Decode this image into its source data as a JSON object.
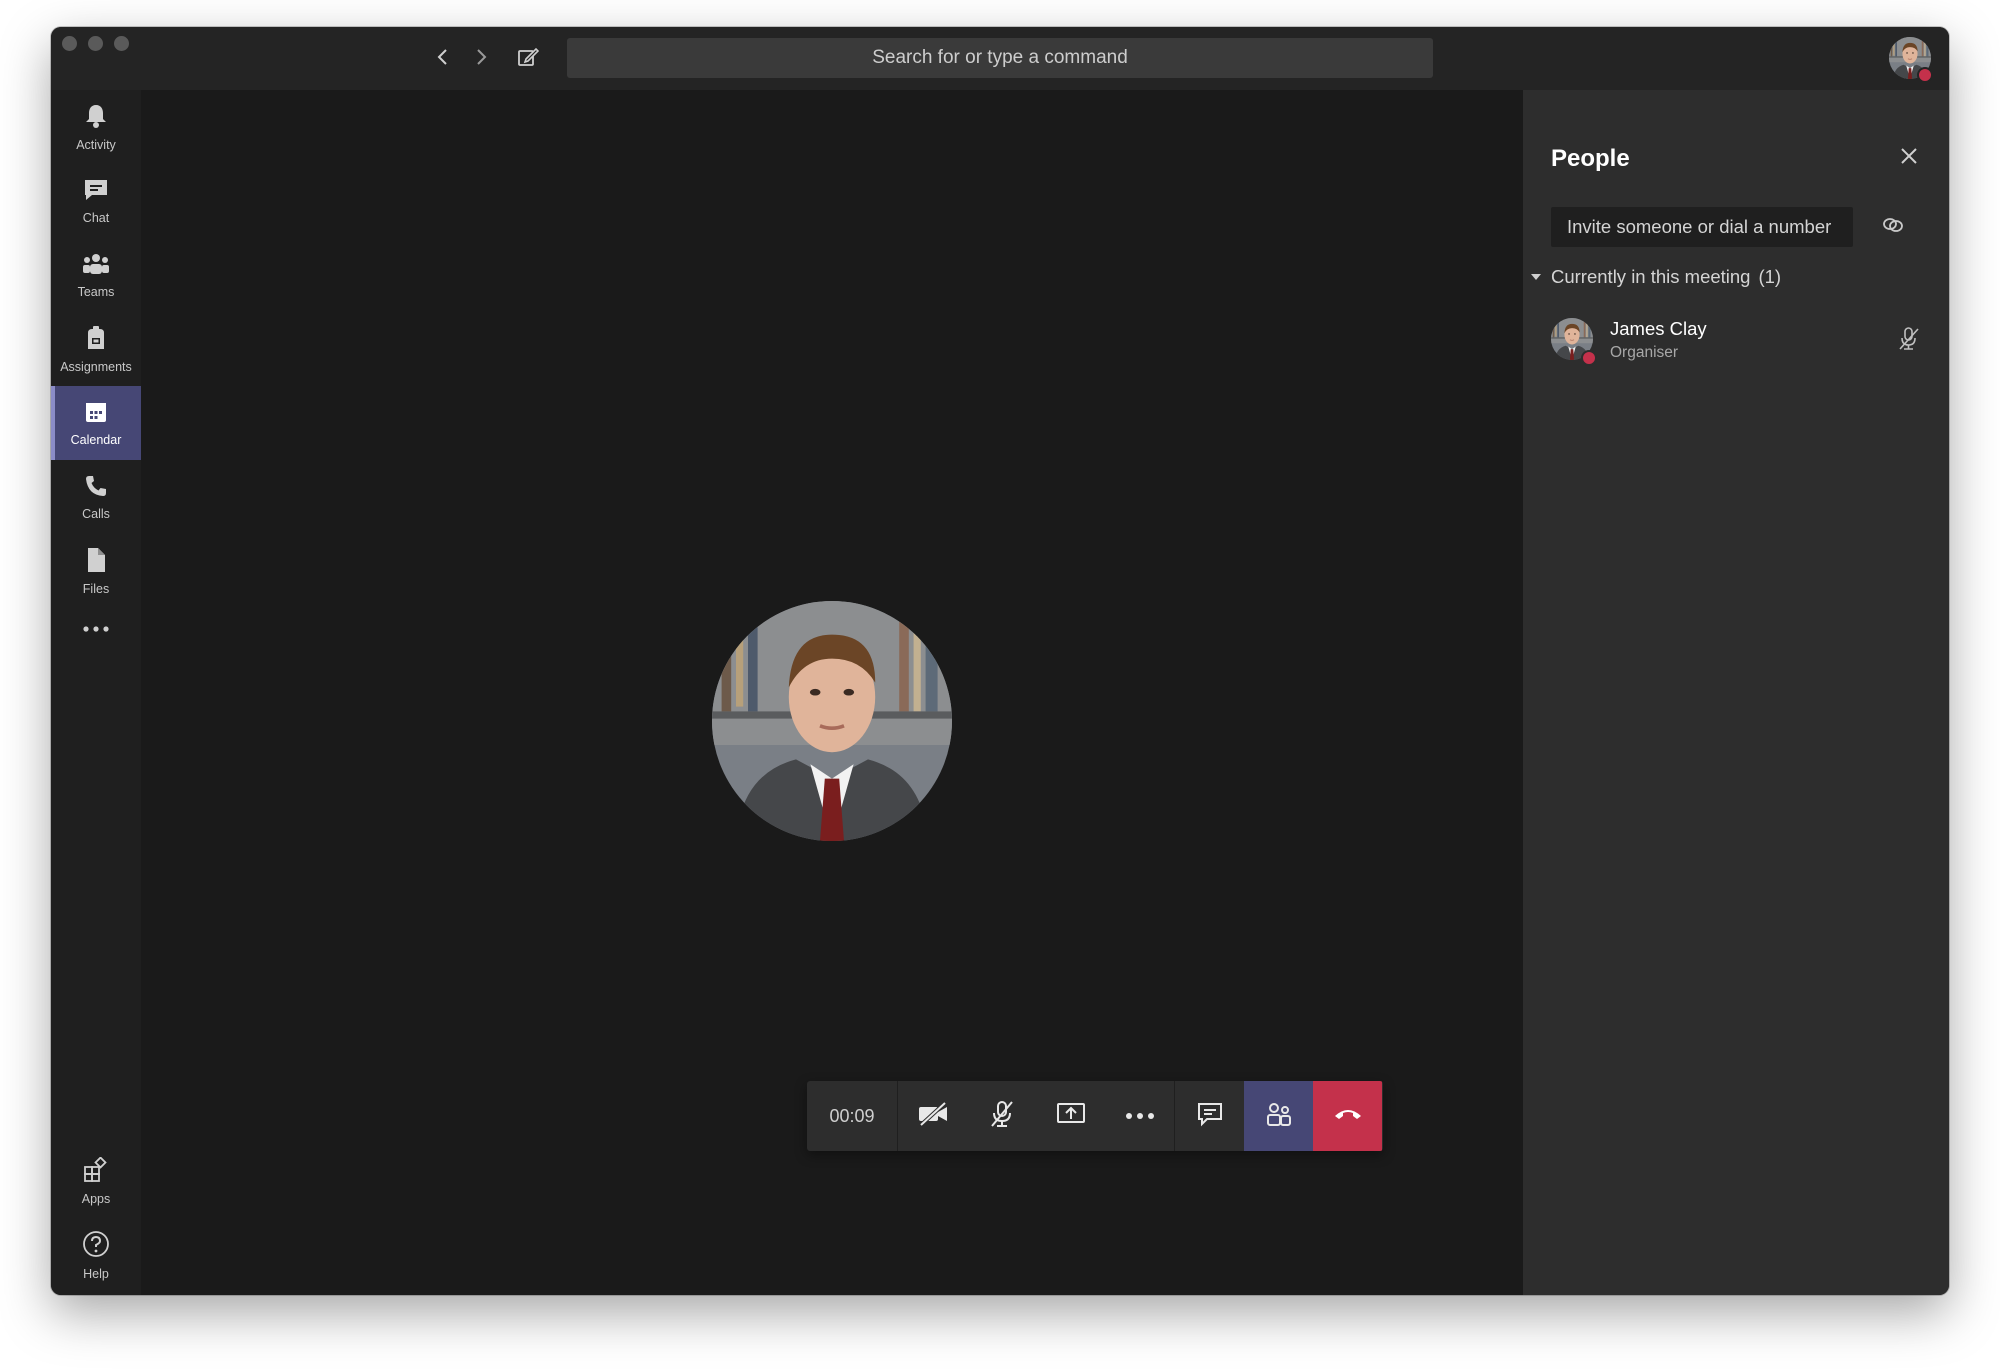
{
  "titlebar": {
    "back_icon": "chevron-left-icon",
    "forward_icon": "chevron-right-icon",
    "compose_icon": "compose-icon",
    "search_placeholder": "Search for or type a command"
  },
  "rail": {
    "items": [
      {
        "label": "Activity",
        "icon": "bell-icon"
      },
      {
        "label": "Chat",
        "icon": "chat-icon"
      },
      {
        "label": "Teams",
        "icon": "teams-icon"
      },
      {
        "label": "Assignments",
        "icon": "assignments-icon"
      },
      {
        "label": "Calendar",
        "icon": "calendar-icon",
        "active": true
      },
      {
        "label": "Calls",
        "icon": "phone-icon"
      },
      {
        "label": "Files",
        "icon": "file-icon"
      }
    ],
    "bottom": [
      {
        "label": "Apps",
        "icon": "apps-icon"
      },
      {
        "label": "Help",
        "icon": "help-icon"
      }
    ]
  },
  "call": {
    "timer": "00:09",
    "controls": [
      "camera-off-icon",
      "mic-off-icon",
      "share-screen-icon",
      "more-icon",
      "chat-icon",
      "people-icon",
      "hang-up-icon"
    ]
  },
  "people_panel": {
    "title": "People",
    "invite_placeholder": "Invite someone or dial a number",
    "section": "Currently in this meeting",
    "count": "(1)",
    "participants": [
      {
        "name": "James Clay",
        "role": "Organiser"
      }
    ]
  },
  "colors": {
    "accent": "#464775",
    "hangup": "#c4314b",
    "background": "#1a1a1a",
    "panel": "#2d2d2d"
  }
}
